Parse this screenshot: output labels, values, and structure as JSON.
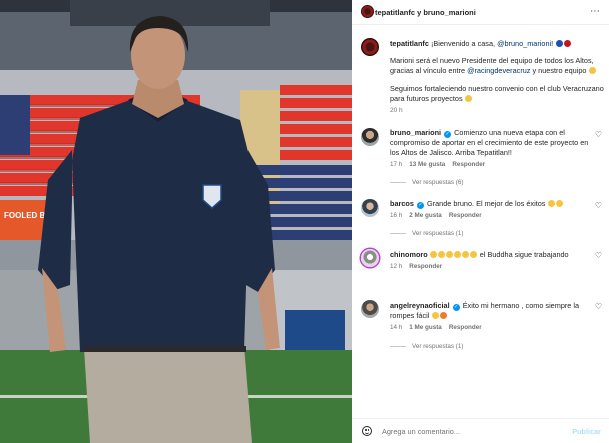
{
  "header": {
    "user": "tepatitlanfc y bruno_marioni",
    "more": "⋯"
  },
  "caption": {
    "username": "tepatitlanfc",
    "line1": "¡Bienvenido a casa, ",
    "mention1": "@bruno_marioni",
    "line1_end": "!",
    "line2": "Marioni será el nuevo Presidente del equipo de todos los Altos,",
    "line3a": "gracias al vínculo entre ",
    "mention2": "@racingdeveracruz",
    "line3b": " y nuestro equipo",
    "line4": "Seguimos fortaleciendo nuestro convenio con el club Veracruzano",
    "line5": "para futuros proyectos",
    "time": "20 h",
    "colors": {
      "blue": "#1d4fb8",
      "red": "#c0171b"
    }
  },
  "comments": [
    {
      "user": "bruno_marioni",
      "verified": true,
      "lines": [
        "Comienzo una nueva etapa con el",
        "compromiso de aportar en el crecimiento de este proyecto en",
        "los Altos de Jalisco. Arriba Tepatitlan!!"
      ],
      "time": "17 h",
      "likes": "13 Me gusta",
      "reply": "Responder",
      "replies": "Ver respuestas (6)"
    },
    {
      "user": "barcos",
      "verified": true,
      "lines": [
        "Grande bruno. El mejor de los éxitos"
      ],
      "time": "16 h",
      "likes": "2 Me gusta",
      "reply": "Responder",
      "replies": "Ver respuestas (1)"
    },
    {
      "user": "chinomoro",
      "verified": false,
      "lines": [
        "el Buddha sigue trabajando"
      ],
      "time": "12 h",
      "likes": "",
      "reply": "Responder",
      "replies": ""
    },
    {
      "user": "angelreynaoficial",
      "verified": true,
      "lines": [
        "Éxito mi hermano , como siempre la",
        "rompes fácil"
      ],
      "time": "14 h",
      "likes": "1 Me gusta",
      "reply": "Responder",
      "replies": "Ver respuestas (1)"
    }
  ],
  "footer": {
    "placeholder": "Agrega un comentario...",
    "publish": "Publicar"
  },
  "photo": {
    "banner_text": "FOOLED BE",
    "stadium_colors": {
      "seats_red": "#e0362c",
      "seats_blue": "#2c3e73",
      "shirt": "#1f2c45",
      "pants": "#b5aca0",
      "grass": "#3f7a3a"
    }
  }
}
